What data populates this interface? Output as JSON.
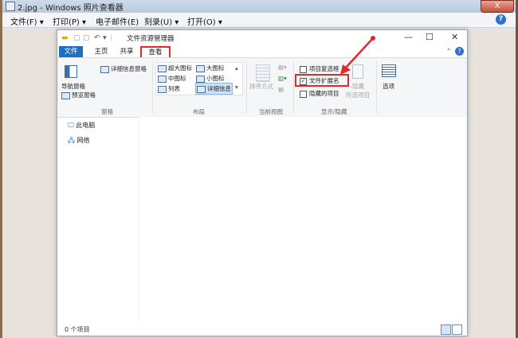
{
  "photo_viewer": {
    "title": "2.jpg - Windows 照片查看器",
    "close_glyph": "X",
    "menu": [
      "文件(F) ▾",
      "打印(P) ▾",
      "电子邮件(E)",
      "刻录(U) ▾",
      "打开(O) ▾"
    ],
    "help": "?"
  },
  "explorer": {
    "title": "文件资源管理器",
    "min_glyph": "—",
    "max_glyph": "☐",
    "close_glyph": "✕",
    "expand_glyph": "⌃",
    "tabs": [
      "文件",
      "主页",
      "共享",
      "查看"
    ],
    "ribbon": {
      "pane": {
        "nav_pane": "导航窗格",
        "preview_pane": "预览窗格",
        "details_pane": "详细信息窗格",
        "label": "窗格"
      },
      "layout": {
        "items": [
          "超大图标",
          "大图标",
          "中图标",
          "小图标",
          "列表",
          "详细信息"
        ],
        "label": "布局"
      },
      "current_view": {
        "sort": "排序方式",
        "label": "当前视图"
      },
      "show_hide": {
        "item_checkboxes": "项目复选框",
        "file_extensions": "文件扩展名",
        "hidden_items": "隐藏的项目",
        "hide_selected_line1": "隐藏",
        "hide_selected_line2": "所选项目",
        "label": "显示/隐藏"
      },
      "options": "选项"
    },
    "nav": {
      "this_pc": "此电脑",
      "network": "网络"
    },
    "status": "0 个项目"
  }
}
